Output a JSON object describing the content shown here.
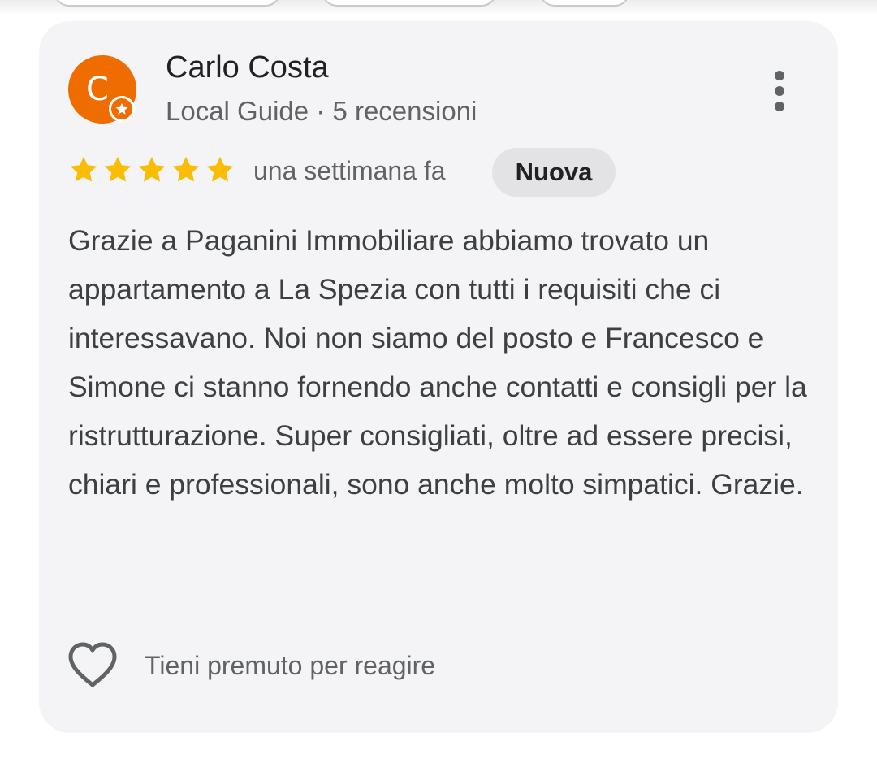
{
  "review": {
    "author": {
      "initial": "C",
      "name": "Carlo Costa",
      "meta": "Local Guide · 5 recensioni",
      "avatar_color": "#ef6c00",
      "badge_icon": "local-guide-star-icon"
    },
    "rating": 5,
    "rating_max": 5,
    "star_color": "#fbbc04",
    "date": "una settimana fa",
    "badge": "Nuova",
    "text": "Grazie a Paganini Immobiliare abbiamo trovato un appartamento a La Spezia con tutti i requisiti che ci interessavano. Noi non siamo del posto e Francesco e Simone ci stanno fornendo anche contatti e consigli per la ristrutturazione. Super consigliati, oltre ad essere precisi, chiari e professionali, sono anche molto simpatici. Grazie.",
    "react": {
      "icon": "heart-outline-icon",
      "label": "Tieni premuto per reagire"
    },
    "menu_icon": "more-vert-icon"
  }
}
